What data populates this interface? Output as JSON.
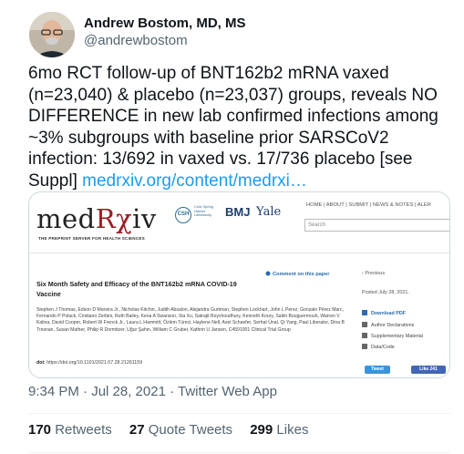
{
  "author": {
    "name": "Andrew Bostom, MD, MS",
    "handle": "@andrewbostom"
  },
  "tweet": {
    "text": "6mo RCT follow-up of BNT162b2 mRNA vaxed (n=23,040) & placebo (n=23,037) groups, reveals NO DIFFERENCE in new lab confirmed infections among ~3% subgroups with baseline prior SARSCoV2 infection: 13/692 in vaxed vs. 17/736 placebo [see Suppl]",
    "link": "medrxiv.org/content/medrxi…"
  },
  "card": {
    "logo_pre": "med",
    "logo_rx": "Rχ",
    "logo_post": "iv",
    "tagline": "THE PREPRINT SERVER FOR HEALTH SCIENCES",
    "csh_badge": "CSH",
    "csh_text": "Cold Spring Harbor Laboratory",
    "bmj": "BMJ",
    "yale": "Yale",
    "nav": "HOME | ABOUT | SUBMIT | NEWS & NOTES | ALER",
    "search_placeholder": "Search",
    "comment_link": "Comment on this paper",
    "previous": "Previous",
    "paper_title": "Six Month Safety and Efficacy of the BNT162b2 mRNA COVID-19 Vaccine",
    "authors": "Stephen J Thomas, Edson D Moreira Jr., Nicholas Kitchin, Judith Absalon, Alejandra Gurtman, Stephen Lockhart, John L Perez, Gonzalo Pérez Marc, Fernando P Polack, Cristiano Zerbini, Ruth Bailey, Kena A Swanson, Xia Xu, Satrajit Roychoudhury, Kenneth Koury, Salim Bouguermouh, Warren V Kalina, David Cooper, Robert W Frenck Jr., Laura L Hammitt, Özlem Türeci, Haylene Nell, Axel Schaefer, Serhat Ünal, Qi Yang, Paul Liberator, Dina B Tresnan, Susan Mather, Philip R Dormitzer, Uğur Şahin, William C Gruber, Kathrin U Jansen, C4591001 Clinical Trial Group",
    "doi_label": "doi:",
    "doi_value": "https://doi.org/10.1101/2021.07.28.21261159",
    "posted": "Posted July 28, 2021.",
    "download_pdf": "Download PDF",
    "author_declarations": "Author Declarations",
    "supplementary": "Supplementary Material",
    "data_code": "Data/Code",
    "tweet_button": "Tweet",
    "like_button": "Like 241"
  },
  "meta": {
    "timestamp": "9:34 PM · Jul 28, 2021 · Twitter Web App"
  },
  "stats": {
    "retweets_count": "170",
    "retweets_label": "Retweets",
    "quotes_count": "27",
    "quotes_label": "Quote Tweets",
    "likes_count": "299",
    "likes_label": "Likes"
  }
}
